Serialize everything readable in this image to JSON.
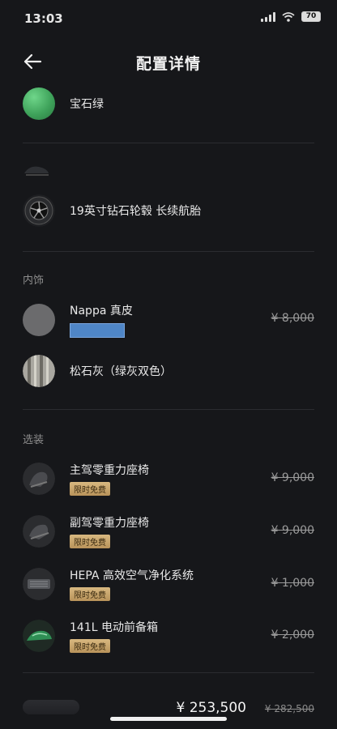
{
  "status_bar": {
    "time": "13:03",
    "battery": "70"
  },
  "header": {
    "title": "配置详情"
  },
  "exterior_color": {
    "label": "宝石绿",
    "color": "#3fa35b"
  },
  "wheels": {
    "label": "19英寸钻石轮毂 长续航胎"
  },
  "interior": {
    "section_label": "内饰",
    "seat_material": {
      "label": "Nappa 真皮",
      "price": "¥ 8,000"
    },
    "color_scheme": {
      "label": "松石灰（绿灰双色）"
    }
  },
  "options": {
    "section_label": "选装",
    "items": [
      {
        "label": "主驾零重力座椅",
        "badge": "限时免费",
        "price": "¥ 9,000"
      },
      {
        "label": "副驾零重力座椅",
        "badge": "限时免费",
        "price": "¥ 9,000"
      },
      {
        "label": "HEPA 高效空气净化系统",
        "badge": "限时免费",
        "price": "¥ 1,000"
      },
      {
        "label": "141L 电动前备箱",
        "badge": "限时免费",
        "price": "¥ 2,000"
      }
    ]
  },
  "footer": {
    "total_price": "¥ 253,500",
    "original_price": "¥ 282,500"
  }
}
